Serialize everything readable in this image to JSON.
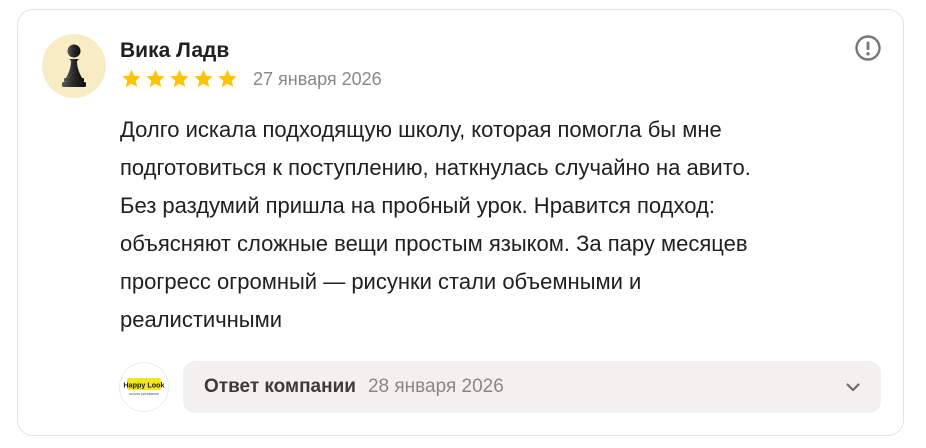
{
  "review": {
    "author": "Вика Ладв",
    "rating": 5,
    "date": "27 января 2026",
    "text": "Долго искала подходящую школу, которая помогла бы мне\nподготовиться к поступлению, наткнулась случайно на авито.\nБез раздумий пришла на пробный урок. Нравится подход:\nобъясняют сложные вещи простым языком. За пару месяцев\nпрогресс огромный — рисунки стали объемными и\nреалистичными"
  },
  "icons": {
    "avatar": "chess-pawn-icon",
    "star": "star-icon",
    "report": "exclamation-circle-icon",
    "expand": "chevron-down-icon"
  },
  "company_reply": {
    "logo_text": "Happy Look",
    "logo_subtext": "школа рисования",
    "label": "Ответ компании",
    "date": "28 января 2026"
  },
  "colors": {
    "star": "#ffc300",
    "card_border": "#e3e3e3",
    "reply_background": "#f2f1f0",
    "secondary_text": "#8a8784",
    "logo_yellow": "#f3e51e"
  }
}
